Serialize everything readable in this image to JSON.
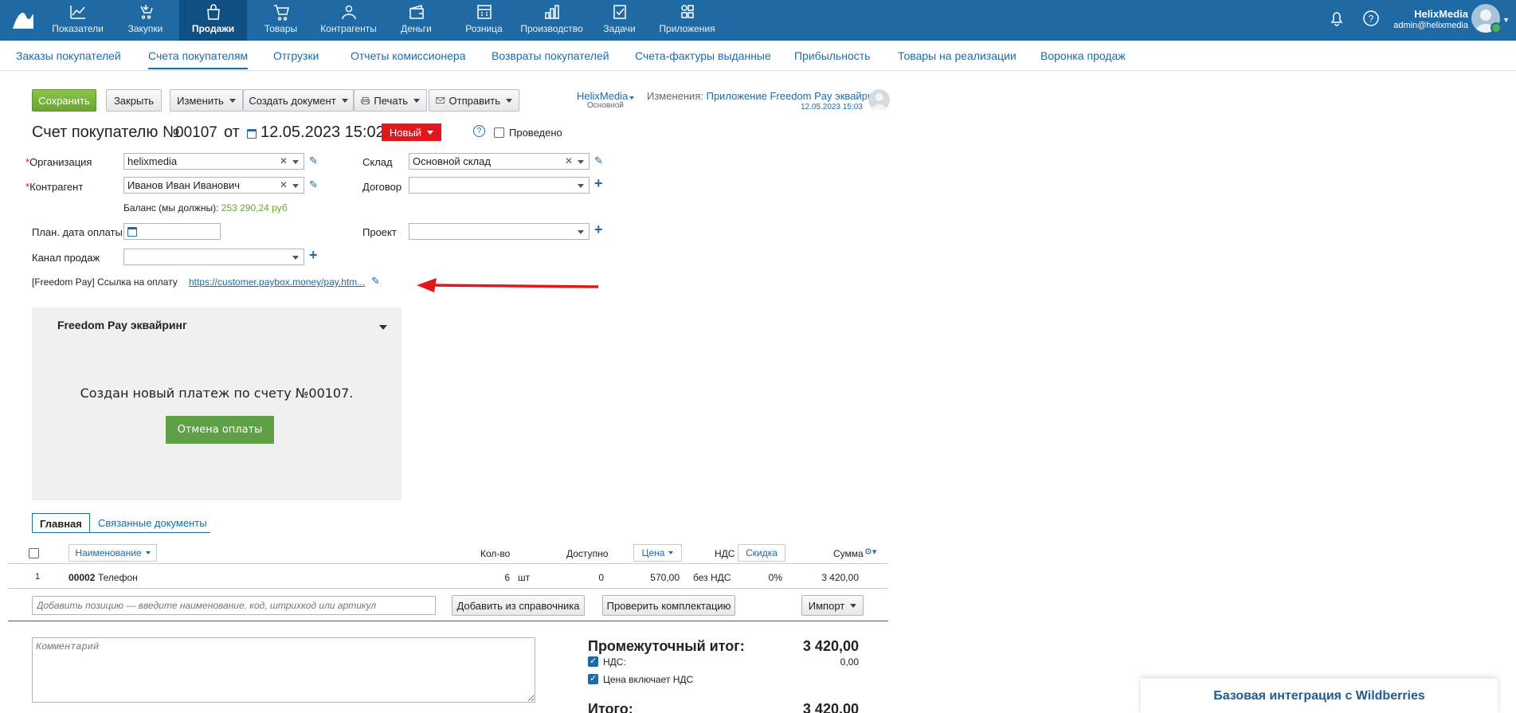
{
  "topnav": {
    "items": [
      {
        "label": "Показатели",
        "icon": "chart-icon"
      },
      {
        "label": "Закупки",
        "icon": "purchases-icon"
      },
      {
        "label": "Продажи",
        "icon": "bag-icon"
      },
      {
        "label": "Товары",
        "icon": "cart-icon"
      },
      {
        "label": "Контрагенты",
        "icon": "people-icon"
      },
      {
        "label": "Деньги",
        "icon": "wallet-icon"
      },
      {
        "label": "Розница",
        "icon": "store-icon"
      },
      {
        "label": "Производство",
        "icon": "factory-icon"
      },
      {
        "label": "Задачи",
        "icon": "tasks-icon"
      },
      {
        "label": "Приложения",
        "icon": "apps-icon"
      }
    ],
    "active_index": 2
  },
  "user": {
    "name": "HelixMedia",
    "email": "admin@helixmedia"
  },
  "subnav": {
    "items": [
      "Заказы покупателей",
      "Счета покупателям",
      "Отгрузки",
      "Отчеты комиссионера",
      "Возвраты покупателей",
      "Счета-фактуры выданные",
      "Прибыльность",
      "Товары на реализации",
      "Воронка продаж"
    ],
    "active_index": 1
  },
  "toolbar": {
    "save": "Сохранить",
    "close": "Закрыть",
    "edit": "Изменить",
    "create_doc": "Создать документ",
    "print": "Печать",
    "send": "Отправить"
  },
  "org_selector": {
    "name": "HelixMedia",
    "sub": "Основной"
  },
  "changes": {
    "label": "Изменения:",
    "value": "Приложение Freedom Pay эквайринг",
    "date": "12.05.2023 15:03"
  },
  "doc": {
    "title": "Счет покупателю №",
    "number": "00107",
    "from": "от",
    "date": "12.05.2023 15:02",
    "status": "Новый",
    "posted_label": "Проведено"
  },
  "form": {
    "org_label": "Организация",
    "org_value": "helixmedia",
    "warehouse_label": "Склад",
    "warehouse_value": "Основной склад",
    "counterparty_label": "Контрагент",
    "counterparty_value": "Иванов Иван Иванович",
    "contract_label": "Договор",
    "contract_value": "",
    "balance_label": "Баланс (мы должны):",
    "balance_value": "253 290,24 руб",
    "pay_date_label": "План. дата оплаты",
    "project_label": "Проект",
    "channel_label": "Канал продаж",
    "freedom_link_label": "[Freedom Pay] Ссылка на оплату",
    "freedom_link_value": "https://customer.paybox.money/pay.htm..."
  },
  "panel": {
    "title": "Freedom Pay эквайринг",
    "message": "Создан новый платеж по счету №00107.",
    "button": "Отмена оплаты"
  },
  "doc_tabs": [
    "Главная",
    "Связанные документы"
  ],
  "table": {
    "headers": {
      "name": "Наименование",
      "qty": "Кол-во",
      "available": "Доступно",
      "price": "Цена",
      "vat": "НДС",
      "discount": "Скидка",
      "sum": "Сумма"
    },
    "rows": [
      {
        "index": "1",
        "code": "00002",
        "name": "Телефон",
        "qty": "6",
        "unit": "шт",
        "available": "0",
        "price": "570,00",
        "vat": "без НДС",
        "discount": "0%",
        "sum": "3 420,00"
      }
    ],
    "add_placeholder": "Добавить позицию — введите наименование, код, штрихкод или артикул",
    "add_from_ref": "Добавить из справочника",
    "check_kit": "Проверить комплектацию",
    "import": "Импорт"
  },
  "comment_placeholder": "Комментарий",
  "totals": {
    "subtotal_label": "Промежуточный итог:",
    "subtotal_value": "3 420,00",
    "vat_label": "НДС:",
    "vat_value": "0,00",
    "price_incl_vat_label": "Цена включает НДС",
    "total_label": "Итого:",
    "total_value": "3 420,00"
  },
  "promo": {
    "label": "Базовая интеграция с Wildberries"
  },
  "colors": {
    "topbar": "#1f6aa5",
    "accent": "#1f6aa5",
    "save": "#6aa533",
    "status": "#e4161d",
    "panel_button": "#5da046"
  }
}
